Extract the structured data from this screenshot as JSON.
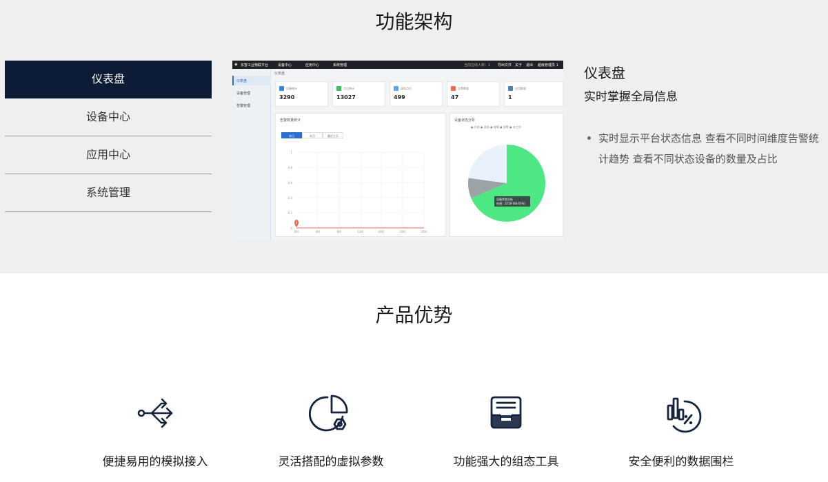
{
  "section_architecture": {
    "title": "功能架构",
    "tabs": [
      {
        "label": "仪表盘",
        "active": true
      },
      {
        "label": "设备中心",
        "active": false
      },
      {
        "label": "应用中心",
        "active": false
      },
      {
        "label": "系统管理",
        "active": false
      }
    ],
    "screenshot": {
      "app_name": "东智工业物联平台",
      "nav": [
        "设备中心",
        "应用中心",
        "系统管理"
      ],
      "top_right": [
        "当前在线人数：1",
        "导出文件",
        "关于",
        "退出",
        "超级管理员 1"
      ],
      "sidebar": [
        "仪表盘",
        "设备管理",
        "告警管理"
      ],
      "breadcrumb": "仪表盘",
      "cards": [
        {
          "label": "设备统计",
          "value": "3290",
          "color": "#2c8be0"
        },
        {
          "label": "点位统计",
          "value": "13027",
          "color": "#3cc063"
        },
        {
          "label": "虚拟点位",
          "value": "499",
          "color": "#5aa7f5"
        },
        {
          "label": "告警数量",
          "value": "47",
          "color": "#ee6b55"
        },
        {
          "label": "应用数量",
          "value": "1",
          "color": "#4b82c4"
        }
      ],
      "alarm_panel": {
        "title": "告警数量统计",
        "tabs": [
          "本日",
          "本月",
          "最近七天"
        ],
        "y_ticks": [
          "1",
          "0.8",
          "0.6",
          "0.4",
          "0.2",
          "0"
        ],
        "x_ticks": [
          "0时",
          "4时",
          "8时",
          "12时",
          "16时",
          "20时",
          "24时"
        ],
        "marker_value": "0"
      },
      "status_panel": {
        "title": "设备状态分析",
        "legend": "● 在线  ● 离线  ● 故障  ● 报警  ● 未工作",
        "tooltip_title": "设备状态分析",
        "tooltip_value": "在线：2258 (68.63%)",
        "slices": [
          {
            "name": "在线",
            "percent": 68.63,
            "color": "#4de884"
          },
          {
            "name": "离线",
            "percent": 8.5,
            "color": "#9aa3a6"
          },
          {
            "name": "未工作",
            "percent": 22.87,
            "color": "#e8f1fc"
          }
        ]
      }
    },
    "feature": {
      "title": "仪表盘",
      "subtitle": "实时掌握全局信息",
      "bullets": [
        "实时显示平台状态信息 查看不同时间维度告警统计趋势 查看不同状态设备的数量及占比"
      ]
    }
  },
  "section_advantages": {
    "title": "产品优势",
    "items": [
      {
        "label": "便捷易用的模拟接入",
        "icon": "share-arrows-icon"
      },
      {
        "label": "灵活搭配的虚拟参数",
        "icon": "pie-gear-icon"
      },
      {
        "label": "功能强大的组态工具",
        "icon": "inbox-tray-icon"
      },
      {
        "label": "安全便利的数据围栏",
        "icon": "chart-percent-icon"
      }
    ]
  },
  "colors": {
    "dark_navy": "#0c1b36",
    "accent": "#2c6fd0"
  }
}
